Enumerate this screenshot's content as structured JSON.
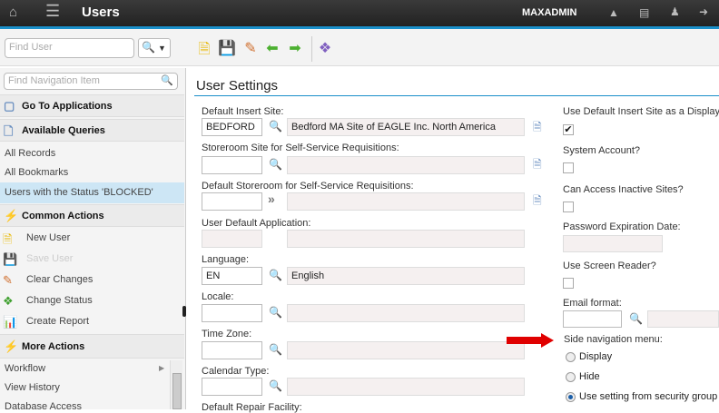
{
  "header": {
    "title": "Users",
    "user": "MAXADMIN"
  },
  "toolbar": {
    "find_placeholder": "Find User"
  },
  "sidebar": {
    "find_placeholder": "Find Navigation Item",
    "go_to_applications": "Go To Applications",
    "available_queries": "Available Queries",
    "queries": [
      "All Records",
      "All Bookmarks",
      "Users with the Status 'BLOCKED'"
    ],
    "common_actions": "Common Actions",
    "actions": [
      "New User",
      "Save User",
      "Clear Changes",
      "Change Status",
      "Create Report"
    ],
    "more_actions": "More Actions",
    "more": [
      "Workflow",
      "View History",
      "Database Access"
    ]
  },
  "main": {
    "title": "User Settings",
    "fields": [
      {
        "label": "Default Insert Site:",
        "value": "BEDFORD",
        "desc": "Bedford MA Site of EAGLE Inc. North America"
      },
      {
        "label": "Storeroom Site for Self-Service Requisitions:",
        "value": "",
        "desc": ""
      },
      {
        "label": "Default Storeroom for Self-Service Requisitions:",
        "value": "",
        "desc": ""
      },
      {
        "label": "User Default Application:",
        "value": "",
        "desc": ""
      },
      {
        "label": "Language:",
        "value": "EN",
        "desc": "English"
      },
      {
        "label": "Locale:",
        "value": "",
        "desc": ""
      },
      {
        "label": "Time Zone:",
        "value": "",
        "desc": ""
      },
      {
        "label": "Calendar Type:",
        "value": "",
        "desc": ""
      },
      {
        "label": "Default Repair Facility:"
      }
    ],
    "right": {
      "display_filter_label": "Use Default Insert Site as a Display Filter",
      "display_filter_checked": true,
      "system_account_label": "System Account?",
      "inactive_sites_label": "Can Access Inactive Sites?",
      "password_exp_label": "Password Expiration Date:",
      "screen_reader_label": "Use Screen Reader?",
      "email_format_label": "Email format:",
      "side_nav_label": "Side navigation menu:",
      "side_nav_options": [
        "Display",
        "Hide",
        "Use setting from security group"
      ],
      "side_nav_selected": "Use setting from security group"
    }
  }
}
